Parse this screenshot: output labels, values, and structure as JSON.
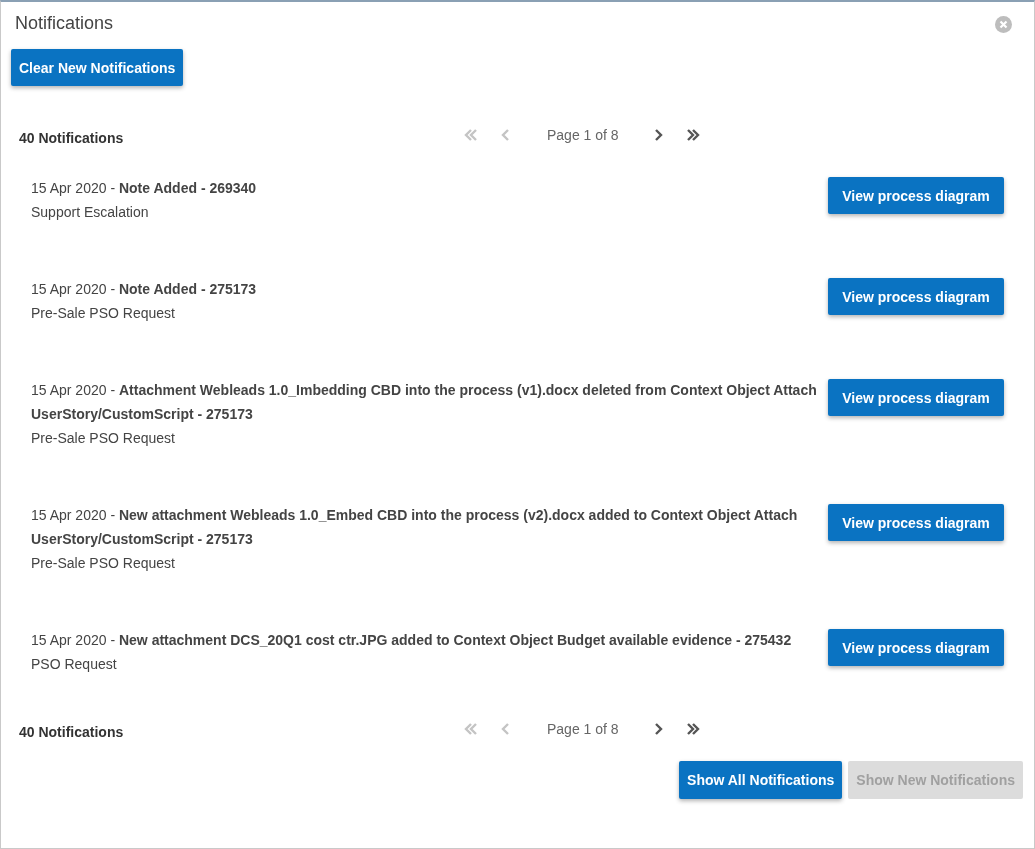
{
  "window": {
    "title": "Notifications"
  },
  "clear_button": "Clear New Notifications",
  "top_pager": {
    "count": "40 Notifications",
    "page": "Page 1 of 8",
    "controls": [
      {
        "kind": "first",
        "disabled": true
      },
      {
        "kind": "prev",
        "disabled": true
      },
      {
        "kind": "next",
        "disabled": false
      },
      {
        "kind": "last",
        "disabled": false
      }
    ]
  },
  "notifications": [
    {
      "date": "15 Apr 2020 - ",
      "title": "Note Added - 269340",
      "subtitle": "Support Escalation",
      "button": "View process diagram"
    },
    {
      "date": "15 Apr 2020 - ",
      "title": "Note Added - 275173",
      "subtitle": "Pre-Sale PSO Request",
      "button": "View process diagram"
    },
    {
      "date": "15 Apr 2020 - ",
      "title": "Attachment Webleads 1.0_Imbedding CBD into the process (v1).docx deleted from Context Object Attach UserStory/CustomScript - 275173",
      "subtitle": "Pre-Sale PSO Request",
      "button": "View process diagram"
    },
    {
      "date": "15 Apr 2020 - ",
      "title": "New attachment Webleads 1.0_Embed CBD into the process (v2).docx added to Context Object Attach UserStory/CustomScript - 275173",
      "subtitle": "Pre-Sale PSO Request",
      "button": "View process diagram"
    },
    {
      "date": "15 Apr 2020 - ",
      "title": "New attachment DCS_20Q1 cost ctr.JPG added to Context Object Budget available evidence - 275432",
      "subtitle": "PSO Request",
      "button": "View process diagram"
    }
  ],
  "bottom_pager": {
    "count": "40 Notifications",
    "page": "Page 1 of 8",
    "controls": [
      {
        "kind": "first",
        "disabled": true
      },
      {
        "kind": "prev",
        "disabled": true
      },
      {
        "kind": "next",
        "disabled": false
      },
      {
        "kind": "last",
        "disabled": false
      }
    ]
  },
  "footer_buttons": [
    {
      "label": "Show All Notifications",
      "disabled": false
    },
    {
      "label": "Show New Notifications",
      "disabled": true
    }
  ]
}
